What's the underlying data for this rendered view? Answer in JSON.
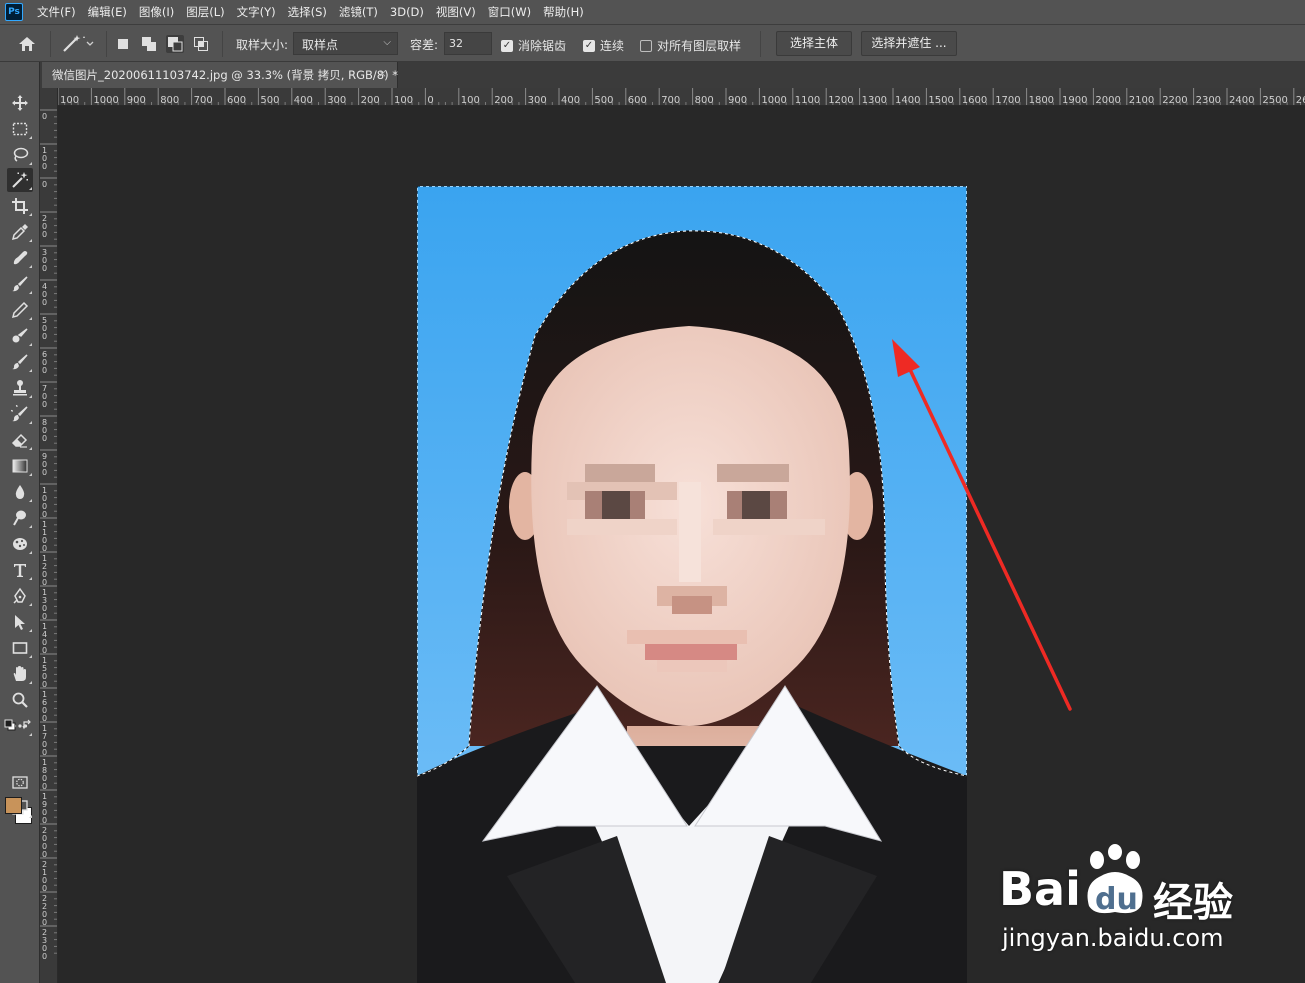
{
  "app": {
    "logo_text": "Ps",
    "menus": [
      "文件(F)",
      "编辑(E)",
      "图像(I)",
      "图层(L)",
      "文字(Y)",
      "选择(S)",
      "滤镜(T)",
      "3D(D)",
      "视图(V)",
      "窗口(W)",
      "帮助(H)"
    ]
  },
  "options": {
    "sample_size_label": "取样大小:",
    "sample_size_value": "取样点",
    "tolerance_label": "容差:",
    "tolerance_value": "32",
    "antialias_label": "消除锯齿",
    "antialias_checked": true,
    "contiguous_label": "连续",
    "contiguous_checked": true,
    "sample_all_layers_label": "对所有图层取样",
    "sample_all_layers_checked": false,
    "select_subject_label": "选择主体",
    "select_and_mask_label": "选择并遮住 ..."
  },
  "document": {
    "collapse_glyph": "››",
    "tab_title": "微信图片_20200611103742.jpg @ 33.3% (背景 拷贝, RGB/8) *",
    "close_glyph": "×"
  },
  "ruler": {
    "h_labels": [
      "100",
      "1000",
      "900",
      "800",
      "700",
      "600",
      "500",
      "400",
      "300",
      "200",
      "100",
      "0",
      "100",
      "200",
      "300",
      "400",
      "500",
      "600",
      "700",
      "800",
      "900",
      "1000",
      "1100",
      "1200",
      "1300",
      "1400",
      "1500",
      "1600",
      "1700",
      "1800",
      "1900",
      "2000",
      "2100",
      "2200",
      "2300",
      "2400",
      "2500",
      "2600"
    ],
    "v_labels": [
      "0",
      "100",
      "0",
      "200",
      "300",
      "400",
      "500",
      "600",
      "700",
      "800",
      "900",
      "1000",
      "1100",
      "1200",
      "1300",
      "1400",
      "1500",
      "1600",
      "1700",
      "1800",
      "1900",
      "2000",
      "2100",
      "2200",
      "2300"
    ]
  },
  "tools": [
    {
      "name": "move-tool",
      "icon": "move-icon"
    },
    {
      "name": "marquee-tool",
      "icon": "marquee-icon"
    },
    {
      "name": "lasso-tool",
      "icon": "lasso-icon"
    },
    {
      "name": "magic-wand-tool",
      "icon": "magic-wand-icon",
      "active": true
    },
    {
      "name": "crop-tool",
      "icon": "crop-icon"
    },
    {
      "name": "eyedropper-tool",
      "icon": "eyedropper-icon"
    },
    {
      "name": "healing-brush-tool",
      "icon": "bandage-icon"
    },
    {
      "name": "brush-tool",
      "icon": "brush-icon"
    },
    {
      "name": "clone-stamp-tool",
      "icon": "stamp-icon"
    },
    {
      "name": "history-brush-tool",
      "icon": "history-brush-icon"
    },
    {
      "name": "eraser-tool",
      "icon": "eraser-icon"
    },
    {
      "name": "gradient-tool",
      "icon": "gradient-icon"
    },
    {
      "name": "blur-tool",
      "icon": "drop-icon"
    },
    {
      "name": "dodge-tool",
      "icon": "dodge-icon"
    },
    {
      "name": "type-tool",
      "icon": "type-icon"
    },
    {
      "name": "pen-tool",
      "icon": "pen-icon"
    },
    {
      "name": "path-selection-tool",
      "icon": "arrow-icon"
    },
    {
      "name": "rectangle-tool",
      "icon": "rectangle-icon"
    },
    {
      "name": "hand-tool",
      "icon": "hand-icon"
    },
    {
      "name": "zoom-tool",
      "icon": "zoom-icon"
    },
    {
      "name": "more-tools",
      "icon": "ellipsis-icon"
    }
  ],
  "colors": {
    "foreground": "#c8935a",
    "background": "#ffffff",
    "photo_background": "#48aaf2",
    "arrow": "#ee2a24"
  },
  "watermark": {
    "main_text": "Bai",
    "du_text": "du",
    "brand_text": "经验",
    "sub_text": "jingyan.baidu.com"
  }
}
